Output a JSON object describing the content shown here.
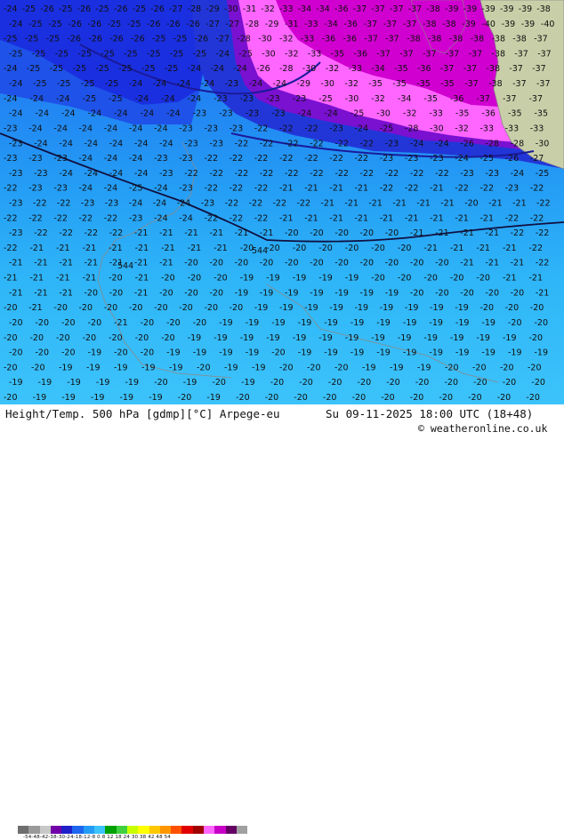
{
  "footer": {
    "title": "Height/Temp. 500 hPa [gdmp][°C] Arpege-eu",
    "datetime": "Su 09-11-2025 18:00 UTC (18+48)",
    "copyright": "© weatheronline.co.uk",
    "colorbar_ticks": "-54-48-42-38-30-24-18-12-8  0  8  12 18 24 30 38 42 48 54"
  },
  "colors": {
    "temp_-25": "#1a2fe0",
    "temp_-24": "#1e66f0",
    "temp_-22": "#249cf5",
    "temp_-20": "#2fb6f8",
    "temp_-19": "#3cc3fa",
    "warm_low": "#ff66ff",
    "warm_high": "#c800c8",
    "land": "#c8cfa8",
    "front_line": "#1a1a9a",
    "colorbar": [
      "#6e6e6e",
      "#9a9a9a",
      "#c8c8c8",
      "#7000a8",
      "#2020c8",
      "#1e66f0",
      "#249cf5",
      "#3cc3fa",
      "#00a000",
      "#40d040",
      "#c8ff00",
      "#ffff00",
      "#ffc800",
      "#ff9600",
      "#ff5000",
      "#e00000",
      "#a00000",
      "#ff66ff",
      "#c800c8",
      "#640064",
      "#a0a0a0"
    ]
  },
  "map": {
    "height_labels": [
      "544",
      "544"
    ],
    "temperature_labels": [
      [
        "24",
        "25",
        "26",
        "25",
        "26",
        "25",
        "26",
        "25",
        "26",
        "27",
        "28",
        "29",
        "30",
        "31",
        "32",
        "33",
        "34",
        "34",
        "36",
        "37",
        "37",
        "37",
        "37",
        "38",
        "39",
        "39",
        "39",
        "39",
        "39",
        "38"
      ],
      [
        "24",
        "25",
        "25",
        "26",
        "26",
        "25",
        "25",
        "26",
        "26",
        "26",
        "27",
        "27",
        "28",
        "29",
        "31",
        "33",
        "34",
        "36",
        "37",
        "37",
        "37",
        "38",
        "38",
        "39",
        "40",
        "39",
        "39",
        "40"
      ],
      [
        "25",
        "25",
        "25",
        "26",
        "26",
        "26",
        "26",
        "25",
        "25",
        "26",
        "27",
        "28",
        "30",
        "32",
        "33",
        "36",
        "36",
        "37",
        "37",
        "38",
        "38",
        "38",
        "38",
        "38",
        "38",
        "37"
      ],
      [
        "25",
        "25",
        "25",
        "25",
        "25",
        "25",
        "25",
        "25",
        "25",
        "24",
        "25",
        "30",
        "32",
        "33",
        "35",
        "36",
        "37",
        "37",
        "37",
        "37",
        "37",
        "38",
        "37",
        "37"
      ],
      [
        "24",
        "25",
        "25",
        "25",
        "25",
        "25",
        "25",
        "25",
        "24",
        "24",
        "24",
        "26",
        "28",
        "30",
        "32",
        "33",
        "34",
        "35",
        "36",
        "37",
        "37",
        "38",
        "37",
        "37"
      ],
      [
        "24",
        "25",
        "25",
        "25",
        "25",
        "24",
        "24",
        "24",
        "24",
        "23",
        "24",
        "24",
        "29",
        "30",
        "32",
        "35",
        "35",
        "35",
        "35",
        "37",
        "38",
        "37",
        "37"
      ],
      [
        "24",
        "24",
        "24",
        "25",
        "25",
        "24",
        "24",
        "24",
        "23",
        "23",
        "23",
        "23",
        "25",
        "30",
        "32",
        "34",
        "35",
        "36",
        "37",
        "37",
        "37"
      ],
      [
        "24",
        "24",
        "24",
        "24",
        "24",
        "24",
        "24",
        "23",
        "23",
        "23",
        "23",
        "24",
        "24",
        "25",
        "30",
        "32",
        "33",
        "35",
        "36",
        "35",
        "35"
      ],
      [
        "23",
        "24",
        "24",
        "24",
        "24",
        "24",
        "24",
        "23",
        "23",
        "23",
        "22",
        "22",
        "22",
        "23",
        "24",
        "25",
        "28",
        "30",
        "32",
        "33",
        "33",
        "33"
      ],
      [
        "23",
        "24",
        "24",
        "24",
        "24",
        "24",
        "24",
        "23",
        "23",
        "22",
        "22",
        "22",
        "22",
        "22",
        "22",
        "23",
        "24",
        "24",
        "26",
        "28",
        "28",
        "30"
      ],
      [
        "23",
        "23",
        "23",
        "24",
        "24",
        "24",
        "23",
        "23",
        "22",
        "22",
        "22",
        "22",
        "22",
        "22",
        "22",
        "23",
        "23",
        "23",
        "24",
        "25",
        "26",
        "27"
      ],
      [
        "23",
        "23",
        "24",
        "24",
        "24",
        "24",
        "23",
        "22",
        "22",
        "22",
        "22",
        "22",
        "22",
        "22",
        "22",
        "22",
        "22",
        "22",
        "23",
        "23",
        "24",
        "25"
      ],
      [
        "22",
        "23",
        "23",
        "24",
        "24",
        "25",
        "24",
        "23",
        "22",
        "22",
        "22",
        "21",
        "21",
        "21",
        "21",
        "22",
        "22",
        "21",
        "22",
        "22",
        "23",
        "22"
      ],
      [
        "23",
        "22",
        "22",
        "23",
        "23",
        "24",
        "24",
        "24",
        "23",
        "22",
        "22",
        "22",
        "22",
        "21",
        "21",
        "21",
        "21",
        "21",
        "21",
        "20",
        "21",
        "21",
        "22"
      ],
      [
        "22",
        "22",
        "22",
        "22",
        "22",
        "23",
        "24",
        "24",
        "22",
        "22",
        "22",
        "21",
        "21",
        "21",
        "21",
        "21",
        "21",
        "21",
        "21",
        "21",
        "22",
        "22"
      ],
      [
        "23",
        "22",
        "22",
        "22",
        "22",
        "21",
        "21",
        "21",
        "21",
        "21",
        "21",
        "20",
        "20",
        "20",
        "20",
        "20",
        "21",
        "21",
        "21",
        "21",
        "22",
        "22"
      ],
      [
        "22",
        "21",
        "21",
        "21",
        "21",
        "21",
        "21",
        "21",
        "21",
        "20",
        "20",
        "20",
        "20",
        "20",
        "20",
        "20",
        "21",
        "21",
        "21",
        "21",
        "22"
      ],
      [
        "21",
        "21",
        "21",
        "21",
        "21",
        "21",
        "21",
        "20",
        "20",
        "20",
        "20",
        "20",
        "20",
        "20",
        "20",
        "20",
        "20",
        "20",
        "21",
        "21",
        "21",
        "22"
      ],
      [
        "21",
        "21",
        "21",
        "21",
        "20",
        "21",
        "20",
        "20",
        "20",
        "19",
        "19",
        "19",
        "19",
        "19",
        "20",
        "20",
        "20",
        "20",
        "20",
        "21",
        "21"
      ],
      [
        "21",
        "21",
        "21",
        "20",
        "20",
        "21",
        "20",
        "20",
        "20",
        "19",
        "19",
        "19",
        "19",
        "19",
        "19",
        "19",
        "20",
        "20",
        "20",
        "20",
        "20",
        "21"
      ],
      [
        "20",
        "21",
        "20",
        "20",
        "20",
        "20",
        "20",
        "20",
        "20",
        "20",
        "19",
        "19",
        "19",
        "19",
        "19",
        "19",
        "19",
        "19",
        "19",
        "20",
        "20",
        "20"
      ],
      [
        "20",
        "20",
        "20",
        "20",
        "21",
        "20",
        "20",
        "20",
        "19",
        "19",
        "19",
        "19",
        "19",
        "19",
        "19",
        "19",
        "19",
        "19",
        "19",
        "20",
        "20"
      ],
      [
        "20",
        "20",
        "20",
        "20",
        "20",
        "20",
        "20",
        "19",
        "19",
        "19",
        "19",
        "19",
        "19",
        "19",
        "19",
        "19",
        "19",
        "19",
        "19",
        "19",
        "20"
      ],
      [
        "20",
        "20",
        "20",
        "19",
        "20",
        "20",
        "19",
        "19",
        "19",
        "19",
        "20",
        "19",
        "19",
        "19",
        "19",
        "19",
        "19",
        "19",
        "19",
        "19",
        "19"
      ],
      [
        "20",
        "20",
        "19",
        "19",
        "19",
        "19",
        "19",
        "20",
        "19",
        "19",
        "20",
        "20",
        "20",
        "19",
        "19",
        "19",
        "20",
        "20",
        "20",
        "20"
      ],
      [
        "19",
        "19",
        "19",
        "19",
        "19",
        "20",
        "19",
        "20",
        "19",
        "20",
        "20",
        "20",
        "20",
        "20",
        "20",
        "20",
        "20",
        "20",
        "20"
      ],
      [
        "20",
        "19",
        "19",
        "19",
        "19",
        "19",
        "20",
        "19",
        "20",
        "20",
        "20",
        "20",
        "20",
        "20",
        "20",
        "20",
        "20",
        "20",
        "20"
      ]
    ]
  }
}
